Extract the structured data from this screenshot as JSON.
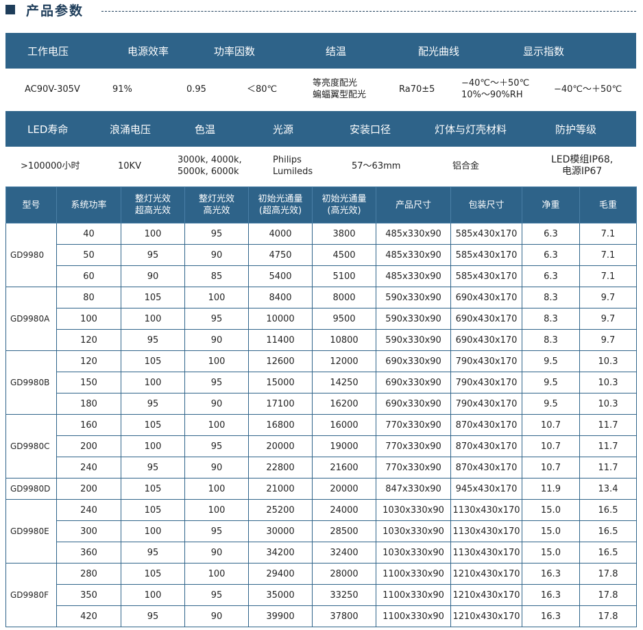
{
  "section_title": "产品参数",
  "colors": {
    "header_bg": "#2e6389",
    "title": "#1e3d5a"
  },
  "summary1": {
    "headers": [
      "工作电压",
      "电源效率",
      "功率因数",
      "结温",
      "配光曲线",
      "显示指数"
    ],
    "values": [
      "AC90V-305V",
      "91%",
      "0.95",
      "＜80℃",
      "等亮度配光",
      "蝙蝠翼型配光",
      "Ra70±5",
      "−40℃～＋50℃",
      "10%～90%RH",
      "−40℃～＋50℃"
    ]
  },
  "summary2": {
    "headers": [
      "LED寿命",
      "浪涌电压",
      "色温",
      "光源",
      "安装口径",
      "灯体与灯壳材料",
      "防护等级"
    ],
    "values": [
      ">100000小时",
      "10KV",
      "3000k, 4000k,",
      "5000k, 6000k",
      "Philips",
      "Lumileds",
      "57～63mm",
      "铝合金",
      "LED模组IP68,",
      "电源IP67"
    ]
  },
  "table": {
    "headers": [
      "型号",
      "系统功率",
      "整灯光效",
      "超高光效",
      "整灯光效",
      "高光效",
      "初始光通量",
      "(超高光效)",
      "初始光通量",
      "(高光效)",
      "产品尺寸",
      "包装尺寸",
      "净重",
      "毛重"
    ],
    "groups": [
      {
        "model": "GD9980",
        "rows": [
          [
            "40",
            "100",
            "95",
            "4000",
            "3800",
            "485x330x90",
            "585x430x170",
            "6.3",
            "7.1"
          ],
          [
            "50",
            "95",
            "90",
            "4750",
            "4500",
            "485x330x90",
            "585x430x170",
            "6.3",
            "7.1"
          ],
          [
            "60",
            "90",
            "85",
            "5400",
            "5100",
            "485x330x90",
            "585x430x170",
            "6.3",
            "7.1"
          ]
        ]
      },
      {
        "model": "GD9980A",
        "rows": [
          [
            "80",
            "105",
            "100",
            "8400",
            "8000",
            "590x330x90",
            "690x430x170",
            "8.3",
            "9.7"
          ],
          [
            "100",
            "100",
            "95",
            "10000",
            "9500",
            "590x330x90",
            "690x430x170",
            "8.3",
            "9.7"
          ],
          [
            "120",
            "95",
            "90",
            "11400",
            "10800",
            "590x330x90",
            "690x430x170",
            "8.3",
            "9.7"
          ]
        ]
      },
      {
        "model": "GD9980B",
        "rows": [
          [
            "120",
            "105",
            "100",
            "12600",
            "12000",
            "690x330x90",
            "790x430x170",
            "9.5",
            "10.3"
          ],
          [
            "150",
            "100",
            "95",
            "15000",
            "14250",
            "690x330x90",
            "790x430x170",
            "9.5",
            "10.3"
          ],
          [
            "180",
            "95",
            "90",
            "17100",
            "16200",
            "690x330x90",
            "790x430x170",
            "9.5",
            "10.3"
          ]
        ]
      },
      {
        "model": "GD9980C",
        "rows": [
          [
            "160",
            "105",
            "100",
            "16800",
            "16000",
            "770x330x90",
            "870x430x170",
            "10.7",
            "11.7"
          ],
          [
            "200",
            "100",
            "95",
            "20000",
            "19000",
            "770x330x90",
            "870x430x170",
            "10.7",
            "11.7"
          ],
          [
            "240",
            "95",
            "90",
            "22800",
            "21600",
            "770x330x90",
            "870x430x170",
            "10.7",
            "11.7"
          ]
        ]
      },
      {
        "model": "GD9980D",
        "rows": [
          [
            "200",
            "105",
            "100",
            "21000",
            "20000",
            "847x330x90",
            "945x430x170",
            "11.9",
            "13.4"
          ]
        ]
      },
      {
        "model": "GD9980E",
        "rows": [
          [
            "240",
            "105",
            "100",
            "25200",
            "24000",
            "1030x330x90",
            "1130x430x170",
            "15.0",
            "16.5"
          ],
          [
            "300",
            "100",
            "95",
            "30000",
            "28500",
            "1030x330x90",
            "1130x430x170",
            "15.0",
            "16.5"
          ],
          [
            "360",
            "95",
            "90",
            "34200",
            "32400",
            "1030x330x90",
            "1130x430x170",
            "15.0",
            "16.5"
          ]
        ]
      },
      {
        "model": "GD9980F",
        "rows": [
          [
            "280",
            "105",
            "100",
            "29400",
            "28000",
            "1100x330x90",
            "1210x430x170",
            "16.3",
            "17.8"
          ],
          [
            "350",
            "100",
            "95",
            "35000",
            "33250",
            "1100x330x90",
            "1210x430x170",
            "16.3",
            "17.8"
          ],
          [
            "420",
            "95",
            "90",
            "39900",
            "37800",
            "1100x330x90",
            "1210x430x170",
            "16.3",
            "17.8"
          ]
        ]
      }
    ]
  }
}
